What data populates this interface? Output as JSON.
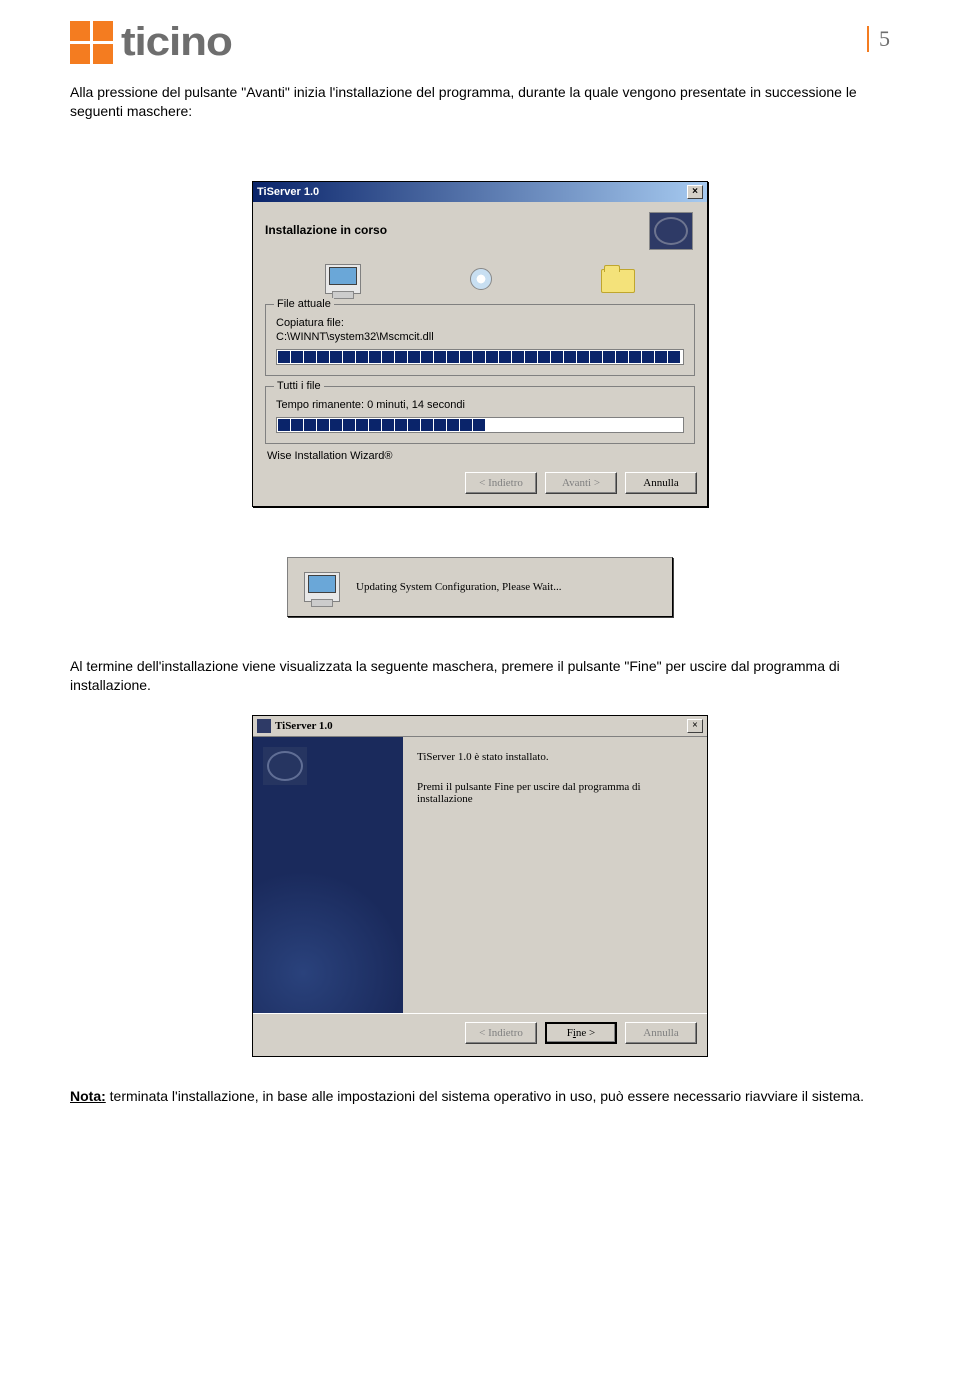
{
  "page": {
    "number": "5",
    "logo_text": "ticino"
  },
  "intro": "Alla pressione del pulsante \"Avanti\" inizia l'installazione del programma, durante la quale vengono presentate in successione le seguenti maschere:",
  "dlg1": {
    "title": "TiServer 1.0",
    "subhead": "Installazione in corso",
    "group1": {
      "title": "File attuale",
      "line1": "Copiatura file:",
      "line2": "C:\\WINNT\\system32\\Mscmcit.dll"
    },
    "group2": {
      "title": "Tutti i file",
      "line": "Tempo rimanente: 0 minuti, 14 secondi"
    },
    "wise": "Wise Installation Wizard®",
    "btn_back": "< Indietro",
    "btn_next": "Avanti >",
    "btn_cancel": "Annulla"
  },
  "dlg2": {
    "text": "Updating System Configuration, Please Wait..."
  },
  "midtext": "Al termine dell'installazione viene visualizzata la seguente maschera, premere il pulsante \"Fine\" per uscire dal programma di installazione.",
  "dlg3": {
    "title": "TiServer 1.0",
    "line1": "TiServer 1.0 è stato installato.",
    "line2": "Premi il pulsante Fine per uscire dal programma di installazione",
    "btn_back": "< Indietro",
    "btn_finish_pre": "F",
    "btn_finish_u": "i",
    "btn_finish_post": "ne >",
    "btn_cancel": "Annulla"
  },
  "note": {
    "label": "Nota:",
    "text": " terminata l'installazione, in base alle impostazioni del sistema operativo in uso, può essere necessario riavviare il sistema."
  }
}
